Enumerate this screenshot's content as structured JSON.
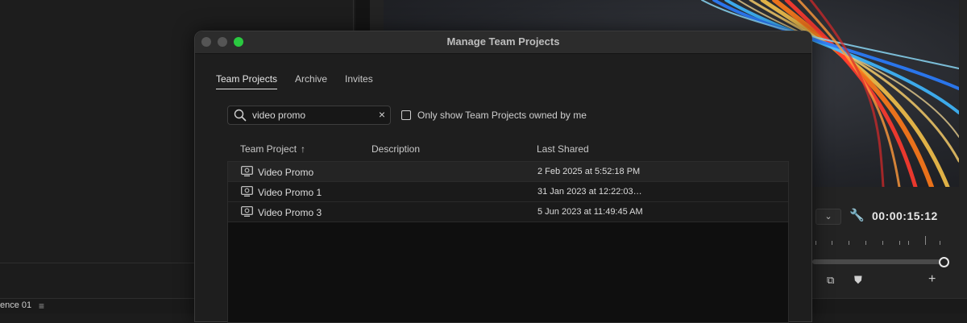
{
  "dialog": {
    "title": "Manage Team Projects",
    "tabs": [
      {
        "label": "Team Projects",
        "active": true
      },
      {
        "label": "Archive",
        "active": false
      },
      {
        "label": "Invites",
        "active": false
      }
    ],
    "search": {
      "value": "video promo",
      "clear_icon": "×"
    },
    "owned_filter": {
      "label": "Only show Team Projects owned by me",
      "checked": false
    },
    "columns": {
      "name": "Team Project",
      "sort_arrow": "↑",
      "description": "Description",
      "last_shared": "Last Shared"
    },
    "rows": [
      {
        "name": "Video Promo",
        "description": "",
        "last_shared": "2 Feb 2025 at 5:52:18 PM"
      },
      {
        "name": "Video Promo 1",
        "description": "",
        "last_shared": "31 Jan 2023 at 12:22:03…"
      },
      {
        "name": "Video Promo 3",
        "description": "",
        "last_shared": "5 Jun 2023 at 11:49:45 AM"
      }
    ]
  },
  "program_monitor": {
    "timecode": "00:00:15:12",
    "dropdown_glyph": "⌄",
    "wrench_glyph": "🔧",
    "add_button_glyph": "+"
  },
  "timeline": {
    "sequence_tab": "ence 01",
    "menu_glyph": "≡"
  },
  "colors": {
    "accent_green": "#2ac940",
    "panel_bg": "#1e1e1e",
    "table_bg": "#0f0f0f"
  }
}
